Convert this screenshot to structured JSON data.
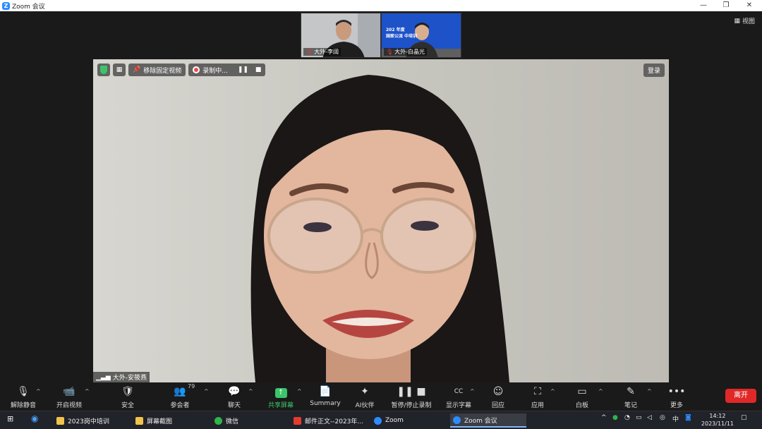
{
  "window": {
    "title": "Zoom 会议",
    "logo_letter": "Z"
  },
  "window_controls": {
    "minimize": "—",
    "restore": "❐",
    "close": "✕"
  },
  "view_button": {
    "label": "视图"
  },
  "thumbnails": [
    {
      "name": "大外-李阔"
    },
    {
      "name": "大外-白晶光",
      "banner_line1": "202  年度",
      "banner_line2": "国家公派          中培训"
    }
  ],
  "main_video": {
    "unpin_label": "移除固定视频",
    "recording_label": "录制中...",
    "pause_icon": "❚❚",
    "stop_icon": "■",
    "login_label": "登录",
    "speaker_name": "大外-安筱燕"
  },
  "toolbar": {
    "items": [
      {
        "label": "解除静音",
        "icon": "🎙"
      },
      {
        "label": "开启视频",
        "icon": "📹"
      },
      {
        "label": "安全",
        "icon": "🛡"
      },
      {
        "label": "参会者",
        "icon": "👥",
        "count": "79"
      },
      {
        "label": "聊天",
        "icon": "💬"
      },
      {
        "label": "共享屏幕",
        "icon": "↑"
      },
      {
        "label": "Summary",
        "icon": "📄"
      },
      {
        "label": "AI伙伴",
        "icon": "✦"
      },
      {
        "label": "暂停/停止录制",
        "icon": "❚❚ ■"
      },
      {
        "label": "显示字幕",
        "icon": "CC"
      },
      {
        "label": "回应",
        "icon": "☺"
      },
      {
        "label": "应用",
        "icon": "⛶"
      },
      {
        "label": "白板",
        "icon": "▭"
      },
      {
        "label": "笔记",
        "icon": "✎"
      },
      {
        "label": "更多",
        "icon": "•••"
      }
    ],
    "leave_label": "离开"
  },
  "taskbar": {
    "items": [
      {
        "label": "2023岗中培训"
      },
      {
        "label": "屏幕截图"
      },
      {
        "label": "微信"
      },
      {
        "label": "邮件正文--2023年..."
      },
      {
        "label": "Zoom"
      },
      {
        "label": "Zoom 会议"
      }
    ],
    "ime": "中",
    "time": "14:12",
    "date": "2023/11/11"
  },
  "colors": {
    "accent": "#2d8cff",
    "share": "#3cc46a",
    "leave": "#e02828",
    "thumb2_bg": "#1d52c9"
  }
}
